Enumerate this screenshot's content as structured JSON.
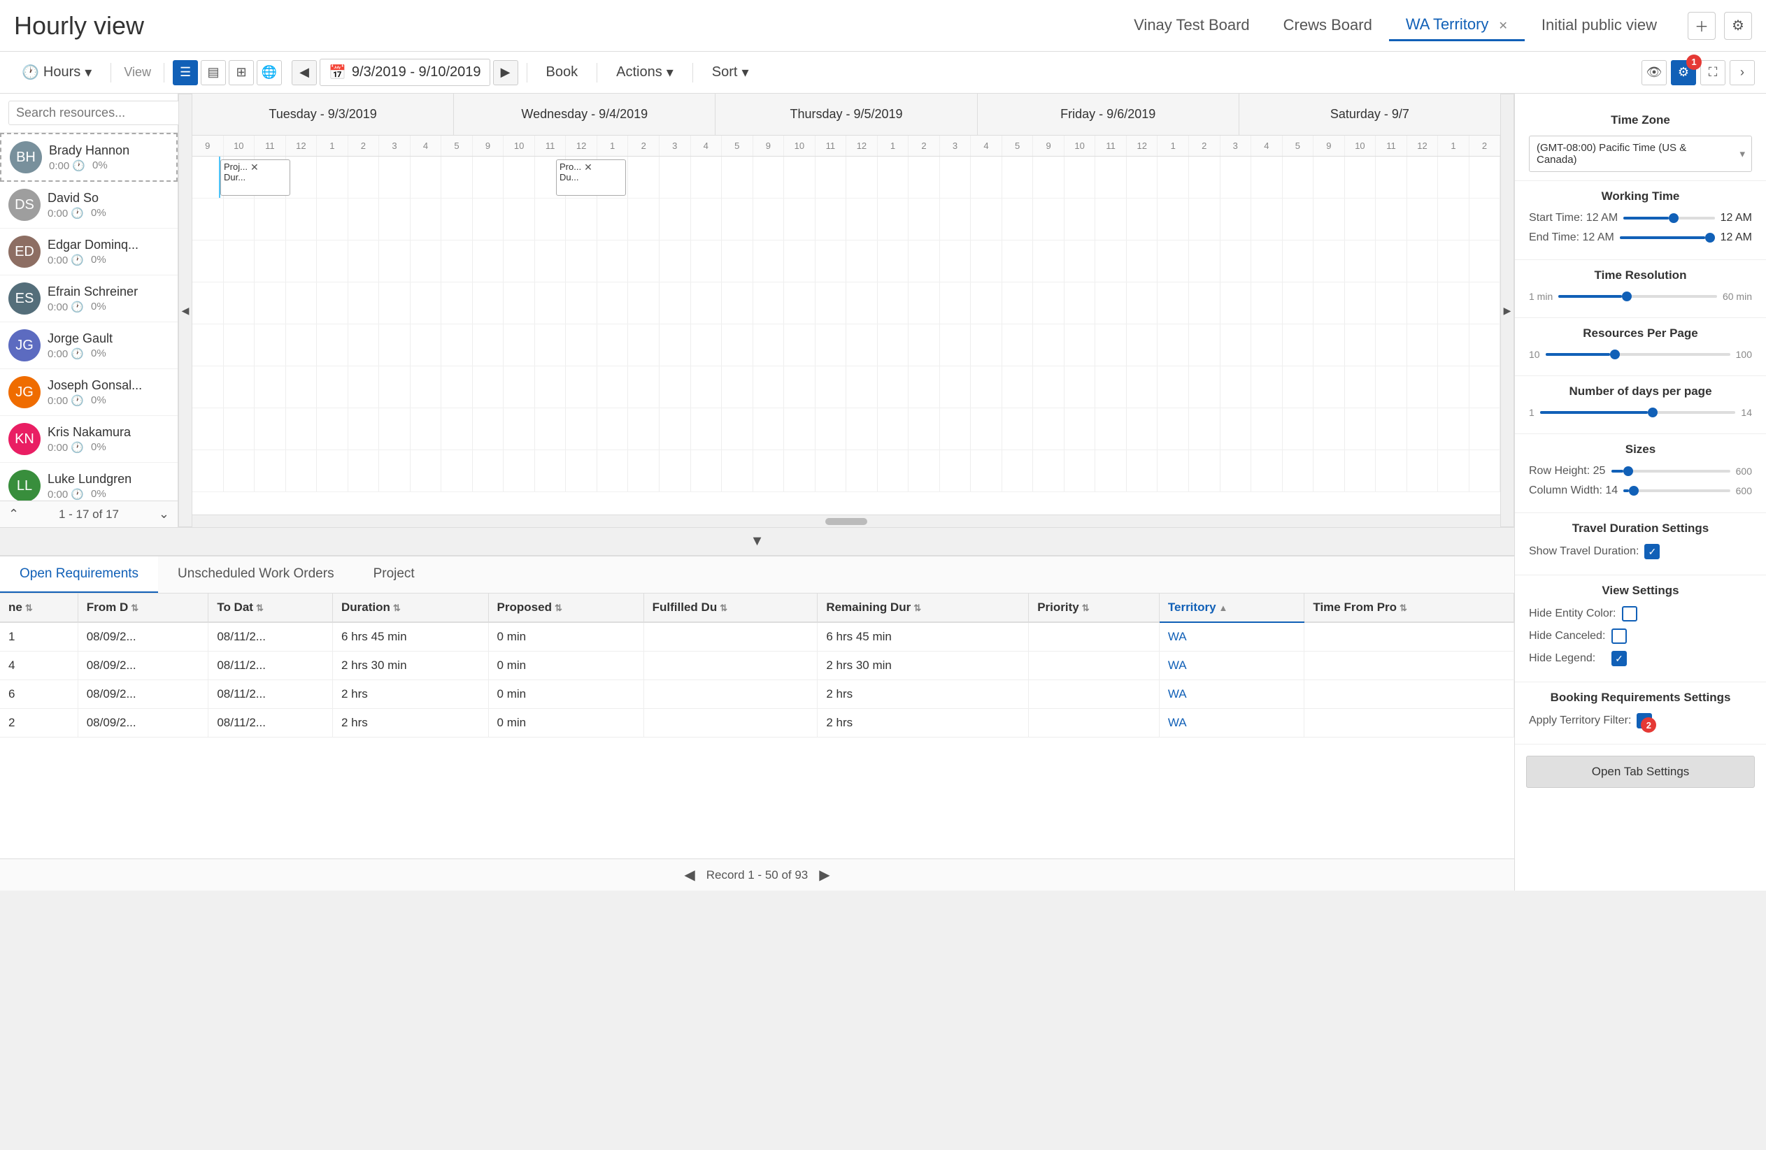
{
  "title": "Hourly view",
  "tabs": [
    {
      "label": "Vinay Test Board",
      "active": false,
      "closable": false
    },
    {
      "label": "Crews Board",
      "active": false,
      "closable": false
    },
    {
      "label": "WA Territory",
      "active": true,
      "closable": true
    },
    {
      "label": "Initial public view",
      "active": false,
      "closable": false
    }
  ],
  "toolbar": {
    "hours_label": "Hours",
    "view_label": "View",
    "book_label": "Book",
    "actions_label": "Actions",
    "sort_label": "Sort",
    "date_range": "9/3/2019 - 9/10/2019"
  },
  "search": {
    "placeholder": "Search resources..."
  },
  "resources": [
    {
      "name": "Brady Hannon",
      "time": "0:00",
      "percent": "0%",
      "initials": "BH",
      "color": "#78909c",
      "selected": true
    },
    {
      "name": "David So",
      "time": "0:00",
      "percent": "0%",
      "initials": "DS",
      "color": "#9e9e9e",
      "selected": false
    },
    {
      "name": "Edgar Dominq...",
      "time": "0:00",
      "percent": "0%",
      "initials": "ED",
      "color": "#8d6e63",
      "selected": false
    },
    {
      "name": "Efrain Schreiner",
      "time": "0:00",
      "percent": "0%",
      "initials": "ES",
      "color": "#546e7a",
      "selected": false
    },
    {
      "name": "Jorge Gault",
      "time": "0:00",
      "percent": "0%",
      "initials": "JG",
      "color": "#5c6bc0",
      "selected": false
    },
    {
      "name": "Joseph Gonsal...",
      "time": "0:00",
      "percent": "0%",
      "initials": "JG",
      "color": "#ef6c00",
      "selected": false
    },
    {
      "name": "Kris Nakamura",
      "time": "0:00",
      "percent": "0%",
      "initials": "KN",
      "color": "#e91e63",
      "selected": false
    },
    {
      "name": "Luke Lundgren",
      "time": "0:00",
      "percent": "0%",
      "initials": "LL",
      "color": "#388e3c",
      "selected": false
    }
  ],
  "pagination": {
    "text": "1 - 17 of 17"
  },
  "calendar": {
    "days": [
      "Tuesday - 9/3/2019",
      "Wednesday - 9/4/2019",
      "Thursday - 9/5/2019",
      "Friday - 9/6/2019",
      "Saturday - 9/7"
    ],
    "hours": [
      "9",
      "10",
      "11",
      "12",
      "1",
      "2",
      "3",
      "4",
      "5",
      "9",
      "10",
      "11",
      "12",
      "1",
      "2",
      "3",
      "4",
      "5",
      "9",
      "10",
      "11",
      "12",
      "1",
      "2",
      "3",
      "4",
      "5",
      "9",
      "10",
      "11",
      "12",
      "1",
      "2",
      "3",
      "4",
      "5",
      "9",
      "10",
      "11",
      "12",
      "1",
      "2"
    ]
  },
  "bookings": [
    {
      "label": "Proj...\nDur...",
      "day": 0,
      "slot": 0,
      "width": 80
    },
    {
      "label": "Pro...\nDu...",
      "day": 1,
      "slot": 3,
      "width": 80
    }
  ],
  "bottom_tabs": [
    {
      "label": "Open Requirements",
      "active": true
    },
    {
      "label": "Unscheduled Work Orders",
      "active": false
    },
    {
      "label": "Project",
      "active": false
    }
  ],
  "table": {
    "columns": [
      {
        "label": "ne",
        "sortable": true,
        "sorted": false
      },
      {
        "label": "From D",
        "sortable": true,
        "sorted": false
      },
      {
        "label": "To Dat",
        "sortable": true,
        "sorted": false
      },
      {
        "label": "Duration",
        "sortable": true,
        "sorted": false
      },
      {
        "label": "Proposed",
        "sortable": true,
        "sorted": false
      },
      {
        "label": "Fulfilled Du",
        "sortable": true,
        "sorted": false
      },
      {
        "label": "Remaining Dur",
        "sortable": true,
        "sorted": false
      },
      {
        "label": "Priority",
        "sortable": true,
        "sorted": false
      },
      {
        "label": "Territory",
        "sortable": true,
        "sorted": true
      },
      {
        "label": "Time From Pro",
        "sortable": true,
        "sorted": false
      }
    ],
    "rows": [
      {
        "id": "1",
        "from": "08/09/2...",
        "to": "08/11/2...",
        "duration": "6 hrs 45 min",
        "proposed": "0 min",
        "fulfilled": "",
        "remaining": "6 hrs 45 min",
        "priority": "",
        "territory": "WA",
        "time_from": ""
      },
      {
        "id": "4",
        "from": "08/09/2...",
        "to": "08/11/2...",
        "duration": "2 hrs 30 min",
        "proposed": "0 min",
        "fulfilled": "",
        "remaining": "2 hrs 30 min",
        "priority": "",
        "territory": "WA",
        "time_from": ""
      },
      {
        "id": "6",
        "from": "08/09/2...",
        "to": "08/11/2...",
        "duration": "2 hrs",
        "proposed": "0 min",
        "fulfilled": "",
        "remaining": "2 hrs",
        "priority": "",
        "territory": "WA",
        "time_from": ""
      },
      {
        "id": "2",
        "from": "08/09/2...",
        "to": "08/11/2...",
        "duration": "2 hrs",
        "proposed": "0 min",
        "fulfilled": "",
        "remaining": "2 hrs",
        "priority": "",
        "territory": "WA",
        "time_from": ""
      }
    ]
  },
  "bottom_footer": {
    "text": "Record 1 - 50 of 93"
  },
  "settings": {
    "title": "Time Zone",
    "timezone": "(GMT-08:00) Pacific Time (US & Canada)",
    "working_time_title": "Working Time",
    "start_time_label": "Start Time: 12 AM",
    "start_time_value": "12 AM",
    "end_time_label": "End Time: 12 AM",
    "end_time_value": "12 AM",
    "time_resolution_title": "Time Resolution",
    "time_resolution_min": "1 min",
    "time_resolution_max": "60 min",
    "resources_per_page_title": "Resources Per Page",
    "resources_per_page_min": "10",
    "resources_per_page_max": "100",
    "days_per_page_title": "Number of days per page",
    "days_per_page_min": "1",
    "days_per_page_max": "14",
    "sizes_title": "Sizes",
    "row_height_label": "Row Height: 25",
    "row_height_min": "25",
    "row_height_max": "600",
    "col_width_label": "Column Width: 14",
    "col_width_min": "14",
    "col_width_max": "600",
    "travel_duration_title": "Travel Duration Settings",
    "show_travel_label": "Show Travel Duration:",
    "view_settings_title": "View Settings",
    "hide_entity_label": "Hide Entity Color:",
    "hide_canceled_label": "Hide Canceled:",
    "hide_legend_label": "Hide Legend:",
    "booking_req_title": "Booking Requirements Settings",
    "apply_territory_label": "Apply Territory Filter:",
    "open_tab_btn": "Open Tab Settings",
    "show_travel_checked": true,
    "hide_entity_checked": false,
    "hide_canceled_checked": false,
    "hide_legend_checked": true,
    "apply_territory_checked": true
  }
}
